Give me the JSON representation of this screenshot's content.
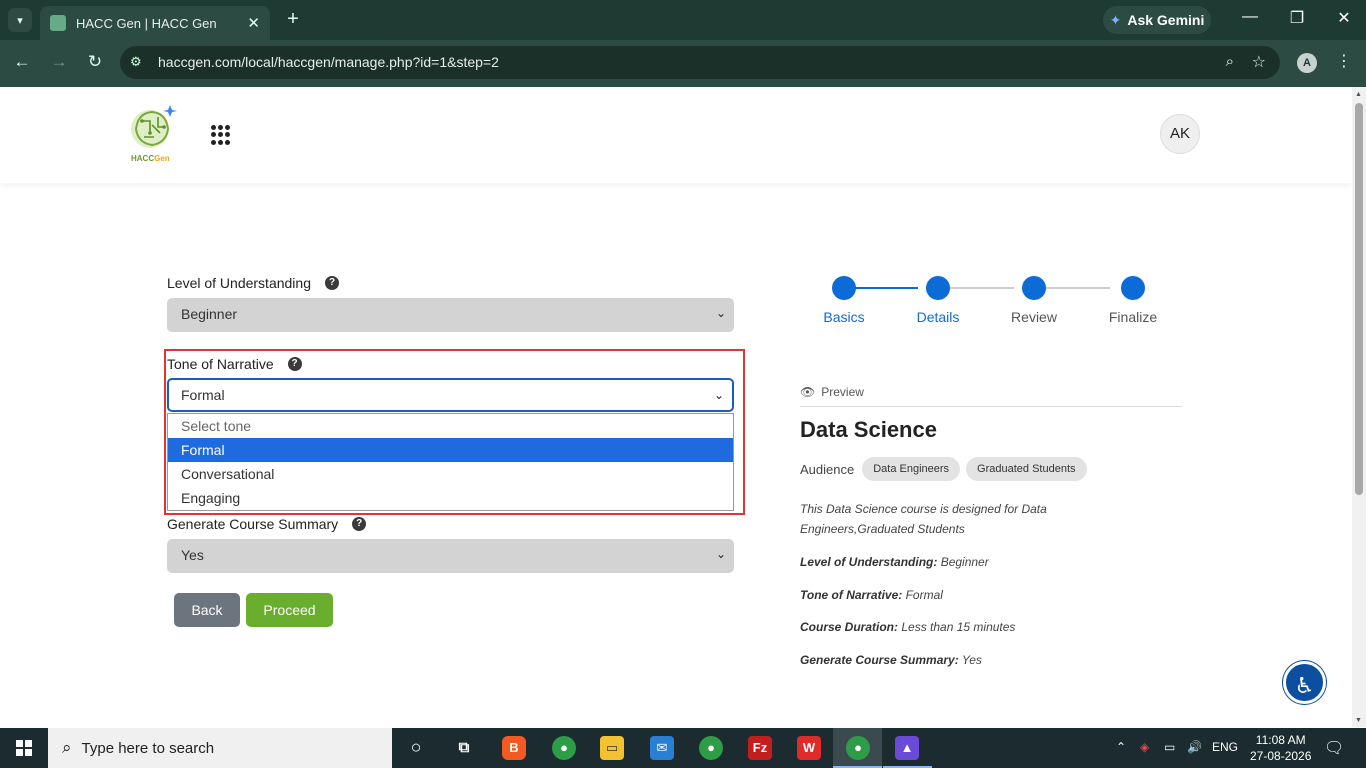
{
  "browser": {
    "tab_title": "HACC Gen | HACC Gen",
    "url": "haccgen.com/local/haccgen/manage.php?id=1&step=2",
    "gemini_label": "Ask Gemini",
    "profile_initial": "A"
  },
  "header": {
    "logo_text_a": "HACC",
    "logo_text_b": "Gen",
    "avatar": "AK"
  },
  "form": {
    "level_label": "Level of Understanding",
    "level_value": "Beginner",
    "tone_label": "Tone of Narrative",
    "tone_value": "Formal",
    "tone_options": [
      "Select tone",
      "Formal",
      "Conversational",
      "Engaging"
    ],
    "summary_label": "Generate Course Summary",
    "summary_value": "Yes",
    "help_glyph": "?",
    "back_label": "Back",
    "proceed_label": "Proceed"
  },
  "stepper": {
    "steps": [
      "Basics",
      "Details",
      "Review",
      "Finalize"
    ],
    "current_step": 2
  },
  "preview": {
    "heading": "Preview",
    "course_title": "Data Science",
    "audience_label": "Audience",
    "audience": [
      "Data Engineers",
      "Graduated Students"
    ],
    "description": "This Data Science course is designed for Data Engineers,Graduated Students",
    "level_key": "Level of Understanding:",
    "level_val": "Beginner",
    "tone_key": "Tone of Narrative:",
    "tone_val": "Formal",
    "duration_key": "Course Duration:",
    "duration_val": "Less than 15 minutes",
    "summary_key": "Generate Course Summary:",
    "summary_val": "Yes"
  },
  "taskbar": {
    "search_placeholder": "Type here to search",
    "lang": "ENG",
    "time": "11:08 AM",
    "date": "27-08-2026"
  },
  "colors": {
    "accent_blue": "#0d6bd8",
    "proceed_green": "#6aae2e",
    "highlight_red": "#e03535"
  }
}
